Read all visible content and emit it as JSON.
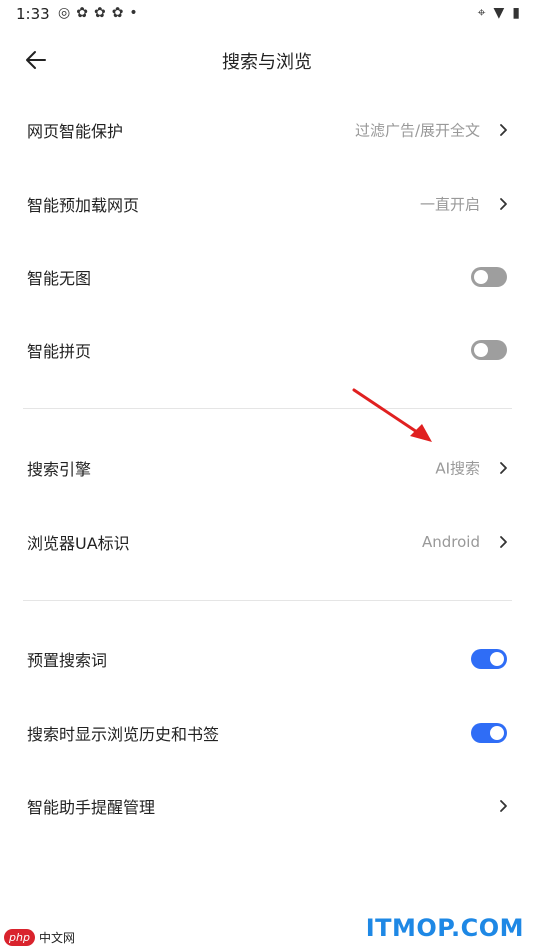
{
  "status": {
    "time": "1:33",
    "left_icons": [
      "weibo-icon",
      "app-icon",
      "app-icon",
      "app-icon",
      "dot-icon"
    ],
    "right_icons": [
      "location-icon",
      "wifi-icon",
      "battery-icon"
    ]
  },
  "header": {
    "title": "搜索与浏览"
  },
  "rows": [
    {
      "label": "网页智能保护",
      "value": "过滤广告/展开全文"
    },
    {
      "label": "智能预加载网页",
      "value": "一直开启"
    },
    {
      "label": "智能无图",
      "toggle": "off"
    },
    {
      "label": "智能拼页",
      "toggle": "off"
    },
    {
      "label": "搜索引擎",
      "value": "AI搜索"
    },
    {
      "label": "浏览器UA标识",
      "value": "Android"
    },
    {
      "label": "预置搜索词",
      "toggle": "on"
    },
    {
      "label": "搜索时显示浏览历史和书签",
      "toggle": "on"
    },
    {
      "label": "智能助手提醒管理"
    }
  ],
  "colors": {
    "accent": "#2f6df6",
    "toggle_off": "#9e9e9e",
    "arrow": "#e02020"
  },
  "watermark": {
    "left_badge": "php",
    "left_text": "中文网",
    "right": "ITMOP.COM"
  }
}
